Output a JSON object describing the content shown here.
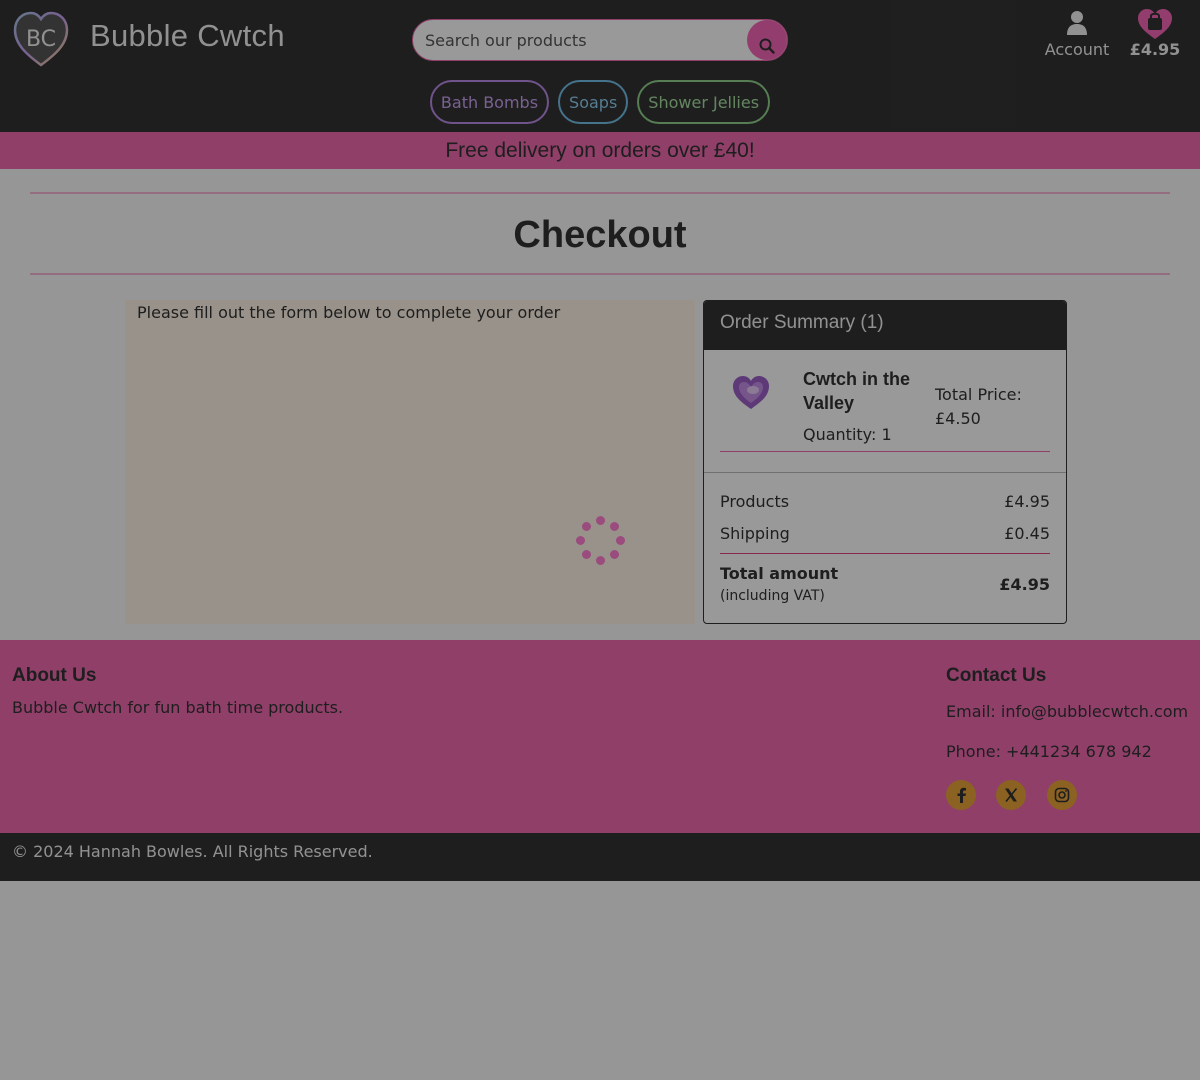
{
  "header": {
    "brand": "Bubble Cwtch",
    "logo_text": "BC",
    "search_placeholder": "Search our products",
    "account_label": "Account",
    "cart_total": "£4.95",
    "nav": [
      "Bath Bombs",
      "Soaps",
      "Shower Jellies"
    ]
  },
  "promo": "Free delivery on orders over £40!",
  "page_title": "Checkout",
  "form": {
    "intro": "Please fill out the form below to complete your order"
  },
  "summary": {
    "title": "Order Summary (1)",
    "item": {
      "name": "Cwtch in the Valley",
      "quantity": "Quantity: 1",
      "price_label": "Total Price:",
      "price": "£4.50"
    },
    "products_label": "Products",
    "products_value": "£4.95",
    "shipping_label": "Shipping",
    "shipping_value": "£0.45",
    "total_label": "Total amount",
    "total_sub": "(including VAT)",
    "total_value": "£4.95"
  },
  "footer": {
    "about_title": "About Us",
    "about_text": "Bubble Cwtch for fun bath time products.",
    "contact_title": "Contact Us",
    "email": "Email: info@bubblecwtch.com",
    "phone": "Phone: +441234 678 942",
    "social_icons": [
      "facebook-icon",
      "x-icon",
      "instagram-icon"
    ]
  },
  "copyright": "© 2024 Hannah Bowles. All Rights Reserved.",
  "colors": {
    "dark": "#333333",
    "pink": "#f06ab0",
    "orange": "#e8a33a",
    "panel": "#fff3e6"
  }
}
